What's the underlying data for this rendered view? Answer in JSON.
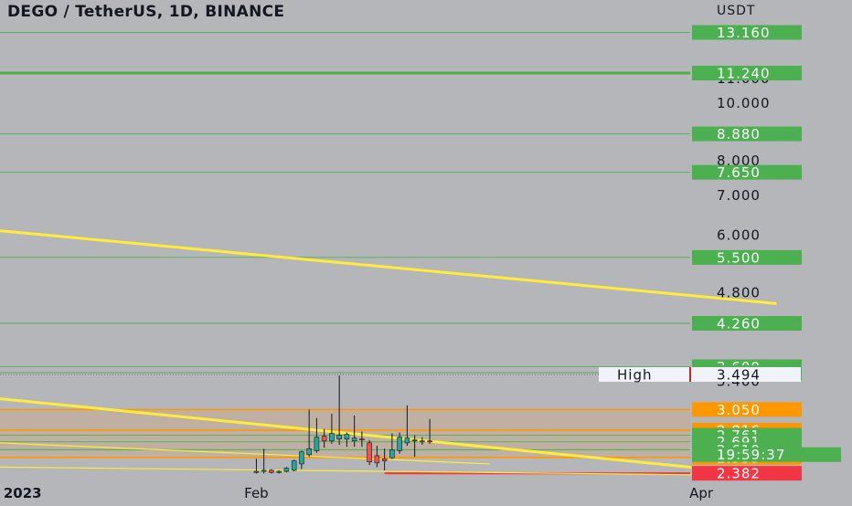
{
  "header": {
    "title": "DEGO / TetherUS, 1D, BINANCE",
    "currency": "USDT"
  },
  "colors": {
    "background": "#b5b6ba",
    "level_green": "#4caf50",
    "level_orange": "#ff9800",
    "level_red": "#f23645",
    "trendline": "#ffeb3b",
    "candle_up": "#26a69a",
    "candle_down": "#ef5350",
    "text": "#131722"
  },
  "chart_data": {
    "type": "candlestick",
    "symbol": "DEGO / TetherUS",
    "interval": "1D",
    "exchange": "BINANCE",
    "y_scale": "log",
    "ylim": [
      2.35,
      14.2
    ],
    "xlim": [
      "2022-12-29",
      "2023-04-21"
    ],
    "y_tick_labels": [
      "11.000",
      "10.000",
      "8.000",
      "7.000",
      "6.000",
      "4.800",
      "3.400"
    ],
    "x_tick_labels": [
      {
        "date": "2023-01-01",
        "label": "2023"
      },
      {
        "date": "2023-02-01",
        "label": "Feb"
      },
      {
        "date": "2023-04-01",
        "label": "Apr"
      }
    ],
    "horizontal_levels": [
      {
        "price": 13.16,
        "label": "13.160",
        "color": "green"
      },
      {
        "price": 11.24,
        "label": "11.240",
        "color": "green"
      },
      {
        "price": 8.88,
        "label": "8.880",
        "color": "green"
      },
      {
        "price": 7.65,
        "label": "7.650",
        "color": "green"
      },
      {
        "price": 5.5,
        "label": "5.500",
        "color": "green"
      },
      {
        "price": 4.26,
        "label": "4.260",
        "color": "green"
      },
      {
        "price": 3.6,
        "label": "3.600",
        "color": "green"
      },
      {
        "price": 3.52,
        "label": "3.520",
        "color": "green"
      },
      {
        "price": 3.05,
        "label": "3.050",
        "color": "orange"
      },
      {
        "price": 2.816,
        "label": "2.816",
        "color": "orange"
      },
      {
        "price": 2.761,
        "label": "2.761",
        "color": "green"
      },
      {
        "price": 2.691,
        "label": "2.691",
        "color": "green"
      },
      {
        "price": 2.61,
        "label": "2.610",
        "color": "green"
      },
      {
        "price": 2.533,
        "label": "2.533",
        "color": "orange"
      },
      {
        "price": 2.382,
        "label": "2.382",
        "color": "red"
      }
    ],
    "high_marker": {
      "label": "High",
      "price": 3.494,
      "price_label": "3.494"
    },
    "countdown": "19:59:37",
    "trendlines": [
      {
        "from": {
          "date": "2022-12-29",
          "price": 6.1
        },
        "to": {
          "date": "2023-04-11",
          "price": 4.6
        }
      },
      {
        "from": {
          "date": "2022-12-29",
          "price": 3.18
        },
        "to": {
          "date": "2023-04-11",
          "price": 2.36
        }
      },
      {
        "from": {
          "date": "2022-12-29",
          "price": 2.68
        },
        "to": {
          "date": "2023-03-04",
          "price": 2.47
        }
      },
      {
        "from": {
          "date": "2022-12-29",
          "price": 2.44
        },
        "to": {
          "date": "2023-04-11",
          "price": 2.36
        }
      }
    ],
    "candles": [
      {
        "date": "2023-02-01",
        "open": 2.39,
        "high": 2.52,
        "low": 2.38,
        "close": 2.4
      },
      {
        "date": "2023-02-02",
        "open": 2.4,
        "high": 2.62,
        "low": 2.38,
        "close": 2.41
      },
      {
        "date": "2023-02-03",
        "open": 2.41,
        "high": 2.42,
        "low": 2.38,
        "close": 2.39
      },
      {
        "date": "2023-02-04",
        "open": 2.39,
        "high": 2.41,
        "low": 2.38,
        "close": 2.4
      },
      {
        "date": "2023-02-05",
        "open": 2.4,
        "high": 2.44,
        "low": 2.39,
        "close": 2.43
      },
      {
        "date": "2023-02-06",
        "open": 2.41,
        "high": 2.51,
        "low": 2.4,
        "close": 2.5
      },
      {
        "date": "2023-02-07",
        "open": 2.47,
        "high": 2.6,
        "low": 2.42,
        "close": 2.59
      },
      {
        "date": "2023-02-08",
        "open": 2.56,
        "high": 3.05,
        "low": 2.54,
        "close": 2.62
      },
      {
        "date": "2023-02-09",
        "open": 2.6,
        "high": 2.95,
        "low": 2.58,
        "close": 2.74
      },
      {
        "date": "2023-02-10",
        "open": 2.75,
        "high": 2.83,
        "low": 2.63,
        "close": 2.7
      },
      {
        "date": "2023-02-11",
        "open": 2.7,
        "high": 3.0,
        "low": 2.67,
        "close": 2.78
      },
      {
        "date": "2023-02-12",
        "open": 2.72,
        "high": 3.48,
        "low": 2.66,
        "close": 2.76
      },
      {
        "date": "2023-02-13",
        "open": 2.72,
        "high": 2.79,
        "low": 2.64,
        "close": 2.77
      },
      {
        "date": "2023-02-14",
        "open": 2.7,
        "high": 2.98,
        "low": 2.64,
        "close": 2.73
      },
      {
        "date": "2023-02-15",
        "open": 2.72,
        "high": 2.8,
        "low": 2.64,
        "close": 2.71
      },
      {
        "date": "2023-02-16",
        "open": 2.68,
        "high": 2.71,
        "low": 2.46,
        "close": 2.49
      },
      {
        "date": "2023-02-17",
        "open": 2.55,
        "high": 2.65,
        "low": 2.44,
        "close": 2.48
      },
      {
        "date": "2023-02-18",
        "open": 2.52,
        "high": 2.62,
        "low": 2.41,
        "close": 2.5
      },
      {
        "date": "2023-02-19",
        "open": 2.53,
        "high": 2.78,
        "low": 2.52,
        "close": 2.61
      },
      {
        "date": "2023-02-20",
        "open": 2.6,
        "high": 2.79,
        "low": 2.57,
        "close": 2.74
      },
      {
        "date": "2023-02-21",
        "open": 2.68,
        "high": 3.1,
        "low": 2.65,
        "close": 2.73
      },
      {
        "date": "2023-02-22",
        "open": 2.7,
        "high": 2.76,
        "low": 2.54,
        "close": 2.71
      },
      {
        "date": "2023-02-23",
        "open": 2.69,
        "high": 2.74,
        "low": 2.66,
        "close": 2.7
      },
      {
        "date": "2023-02-24",
        "open": 2.7,
        "high": 2.94,
        "low": 2.67,
        "close": 2.69
      }
    ]
  }
}
